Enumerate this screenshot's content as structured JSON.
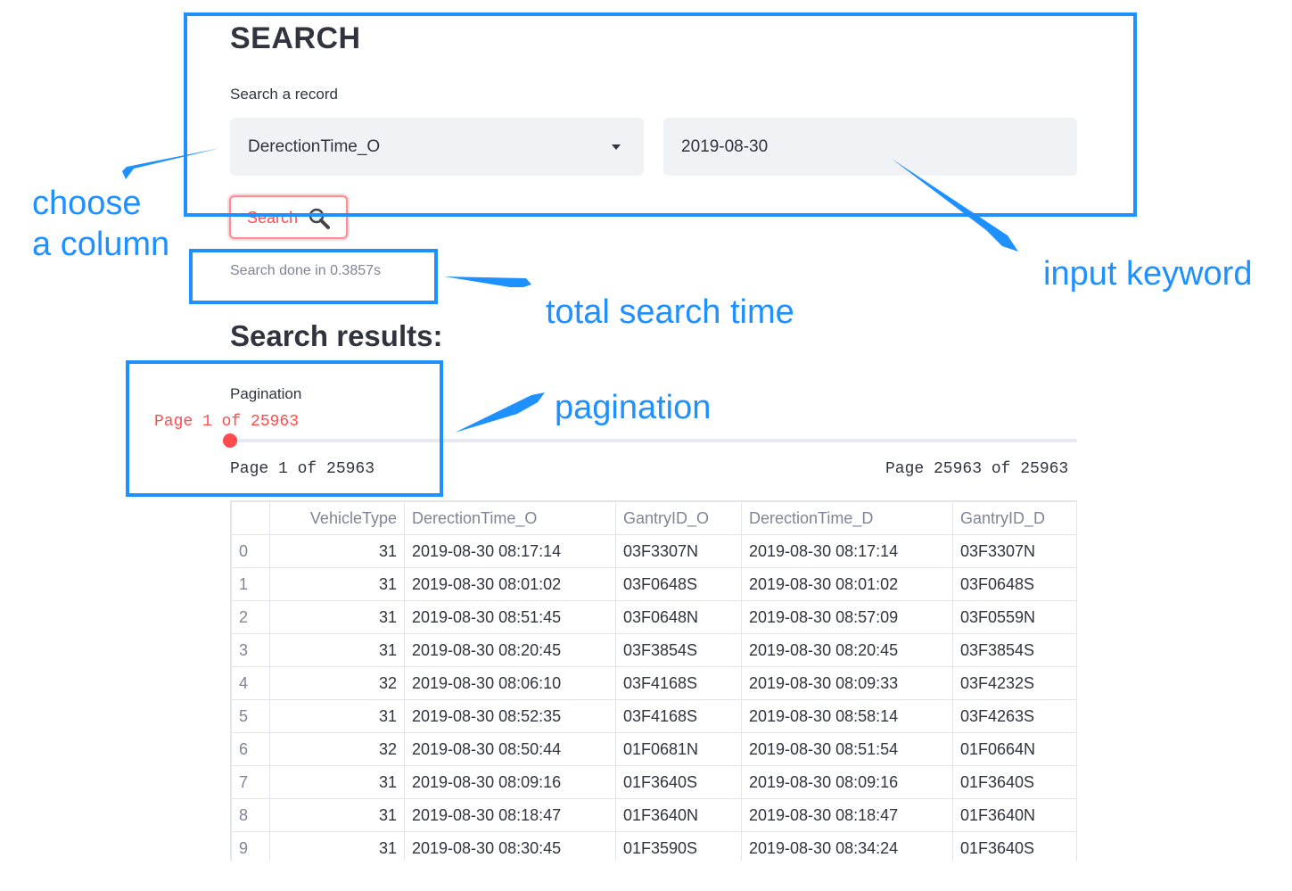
{
  "app": {
    "title": "SEARCH"
  },
  "search": {
    "label": "Search a record",
    "column_selected": "DerectionTime_O",
    "keyword_value": "2019-08-30",
    "button_label": "Search",
    "time_text": "Search done in 0.3857s"
  },
  "results": {
    "heading": "Search results:"
  },
  "pagination": {
    "label": "Pagination",
    "current_text": "Page 1 of 25963",
    "min_text": "Page 1 of 25963",
    "max_text": "Page 25963 of 25963",
    "current_page": 1,
    "total_pages": 25963
  },
  "table": {
    "columns": [
      "",
      "VehicleType",
      "DerectionTime_O",
      "GantryID_O",
      "DerectionTime_D",
      "GantryID_D"
    ],
    "rows": [
      [
        "0",
        "31",
        "2019-08-30 08:17:14",
        "03F3307N",
        "2019-08-30 08:17:14",
        "03F3307N"
      ],
      [
        "1",
        "31",
        "2019-08-30 08:01:02",
        "03F0648S",
        "2019-08-30 08:01:02",
        "03F0648S"
      ],
      [
        "2",
        "31",
        "2019-08-30 08:51:45",
        "03F0648N",
        "2019-08-30 08:57:09",
        "03F0559N"
      ],
      [
        "3",
        "31",
        "2019-08-30 08:20:45",
        "03F3854S",
        "2019-08-30 08:20:45",
        "03F3854S"
      ],
      [
        "4",
        "32",
        "2019-08-30 08:06:10",
        "03F4168S",
        "2019-08-30 08:09:33",
        "03F4232S"
      ],
      [
        "5",
        "31",
        "2019-08-30 08:52:35",
        "03F4168S",
        "2019-08-30 08:58:14",
        "03F4263S"
      ],
      [
        "6",
        "32",
        "2019-08-30 08:50:44",
        "01F0681N",
        "2019-08-30 08:51:54",
        "01F0664N"
      ],
      [
        "7",
        "31",
        "2019-08-30 08:09:16",
        "01F3640S",
        "2019-08-30 08:09:16",
        "01F3640S"
      ],
      [
        "8",
        "31",
        "2019-08-30 08:18:47",
        "01F3640N",
        "2019-08-30 08:18:47",
        "01F3640N"
      ],
      [
        "9",
        "31",
        "2019-08-30 08:30:45",
        "01F3590S",
        "2019-08-30 08:34:24",
        "01F3640S"
      ]
    ]
  },
  "annotations": {
    "choose_column": [
      "choose",
      "a column"
    ],
    "input_keyword": "input keyword",
    "total_search_time": "total search time",
    "pagination": "pagination",
    "color": "#1e90ff"
  },
  "colors": {
    "accent": "#ff4b4b",
    "text": "#31333f",
    "muted": "#808495",
    "field_bg": "#f0f2f6"
  },
  "icons": {
    "search_button_icon": "magnifier-icon",
    "select_icon": "caret-down-icon"
  }
}
